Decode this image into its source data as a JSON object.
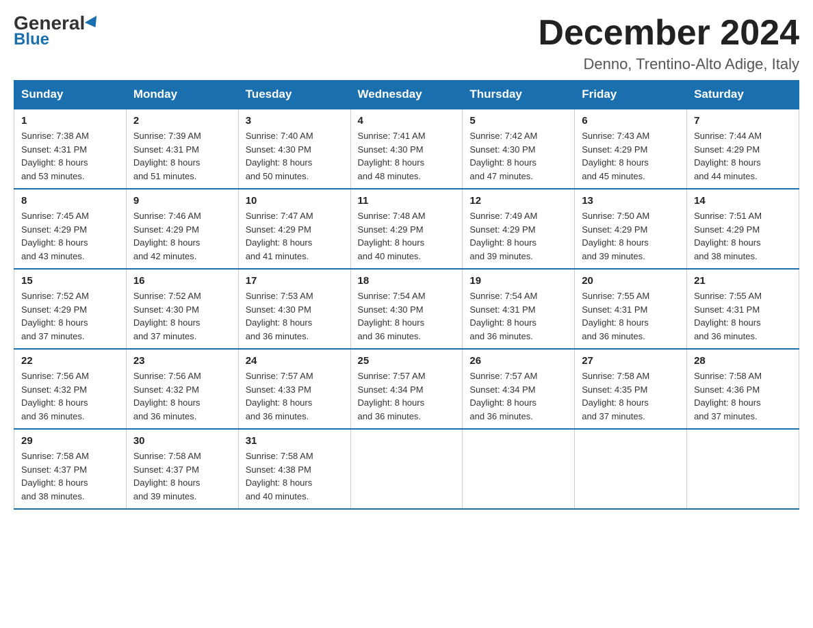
{
  "header": {
    "logo_general": "General",
    "logo_blue": "Blue",
    "month_title": "December 2024",
    "subtitle": "Denno, Trentino-Alto Adige, Italy"
  },
  "days_of_week": [
    "Sunday",
    "Monday",
    "Tuesday",
    "Wednesday",
    "Thursday",
    "Friday",
    "Saturday"
  ],
  "weeks": [
    [
      {
        "day": "1",
        "sunrise": "7:38 AM",
        "sunset": "4:31 PM",
        "daylight": "8 hours and 53 minutes."
      },
      {
        "day": "2",
        "sunrise": "7:39 AM",
        "sunset": "4:31 PM",
        "daylight": "8 hours and 51 minutes."
      },
      {
        "day": "3",
        "sunrise": "7:40 AM",
        "sunset": "4:30 PM",
        "daylight": "8 hours and 50 minutes."
      },
      {
        "day": "4",
        "sunrise": "7:41 AM",
        "sunset": "4:30 PM",
        "daylight": "8 hours and 48 minutes."
      },
      {
        "day": "5",
        "sunrise": "7:42 AM",
        "sunset": "4:30 PM",
        "daylight": "8 hours and 47 minutes."
      },
      {
        "day": "6",
        "sunrise": "7:43 AM",
        "sunset": "4:29 PM",
        "daylight": "8 hours and 45 minutes."
      },
      {
        "day": "7",
        "sunrise": "7:44 AM",
        "sunset": "4:29 PM",
        "daylight": "8 hours and 44 minutes."
      }
    ],
    [
      {
        "day": "8",
        "sunrise": "7:45 AM",
        "sunset": "4:29 PM",
        "daylight": "8 hours and 43 minutes."
      },
      {
        "day": "9",
        "sunrise": "7:46 AM",
        "sunset": "4:29 PM",
        "daylight": "8 hours and 42 minutes."
      },
      {
        "day": "10",
        "sunrise": "7:47 AM",
        "sunset": "4:29 PM",
        "daylight": "8 hours and 41 minutes."
      },
      {
        "day": "11",
        "sunrise": "7:48 AM",
        "sunset": "4:29 PM",
        "daylight": "8 hours and 40 minutes."
      },
      {
        "day": "12",
        "sunrise": "7:49 AM",
        "sunset": "4:29 PM",
        "daylight": "8 hours and 39 minutes."
      },
      {
        "day": "13",
        "sunrise": "7:50 AM",
        "sunset": "4:29 PM",
        "daylight": "8 hours and 39 minutes."
      },
      {
        "day": "14",
        "sunrise": "7:51 AM",
        "sunset": "4:29 PM",
        "daylight": "8 hours and 38 minutes."
      }
    ],
    [
      {
        "day": "15",
        "sunrise": "7:52 AM",
        "sunset": "4:29 PM",
        "daylight": "8 hours and 37 minutes."
      },
      {
        "day": "16",
        "sunrise": "7:52 AM",
        "sunset": "4:30 PM",
        "daylight": "8 hours and 37 minutes."
      },
      {
        "day": "17",
        "sunrise": "7:53 AM",
        "sunset": "4:30 PM",
        "daylight": "8 hours and 36 minutes."
      },
      {
        "day": "18",
        "sunrise": "7:54 AM",
        "sunset": "4:30 PM",
        "daylight": "8 hours and 36 minutes."
      },
      {
        "day": "19",
        "sunrise": "7:54 AM",
        "sunset": "4:31 PM",
        "daylight": "8 hours and 36 minutes."
      },
      {
        "day": "20",
        "sunrise": "7:55 AM",
        "sunset": "4:31 PM",
        "daylight": "8 hours and 36 minutes."
      },
      {
        "day": "21",
        "sunrise": "7:55 AM",
        "sunset": "4:31 PM",
        "daylight": "8 hours and 36 minutes."
      }
    ],
    [
      {
        "day": "22",
        "sunrise": "7:56 AM",
        "sunset": "4:32 PM",
        "daylight": "8 hours and 36 minutes."
      },
      {
        "day": "23",
        "sunrise": "7:56 AM",
        "sunset": "4:32 PM",
        "daylight": "8 hours and 36 minutes."
      },
      {
        "day": "24",
        "sunrise": "7:57 AM",
        "sunset": "4:33 PM",
        "daylight": "8 hours and 36 minutes."
      },
      {
        "day": "25",
        "sunrise": "7:57 AM",
        "sunset": "4:34 PM",
        "daylight": "8 hours and 36 minutes."
      },
      {
        "day": "26",
        "sunrise": "7:57 AM",
        "sunset": "4:34 PM",
        "daylight": "8 hours and 36 minutes."
      },
      {
        "day": "27",
        "sunrise": "7:58 AM",
        "sunset": "4:35 PM",
        "daylight": "8 hours and 37 minutes."
      },
      {
        "day": "28",
        "sunrise": "7:58 AM",
        "sunset": "4:36 PM",
        "daylight": "8 hours and 37 minutes."
      }
    ],
    [
      {
        "day": "29",
        "sunrise": "7:58 AM",
        "sunset": "4:37 PM",
        "daylight": "8 hours and 38 minutes."
      },
      {
        "day": "30",
        "sunrise": "7:58 AM",
        "sunset": "4:37 PM",
        "daylight": "8 hours and 39 minutes."
      },
      {
        "day": "31",
        "sunrise": "7:58 AM",
        "sunset": "4:38 PM",
        "daylight": "8 hours and 40 minutes."
      },
      null,
      null,
      null,
      null
    ]
  ],
  "labels": {
    "sunrise": "Sunrise:",
    "sunset": "Sunset:",
    "daylight": "Daylight:"
  }
}
